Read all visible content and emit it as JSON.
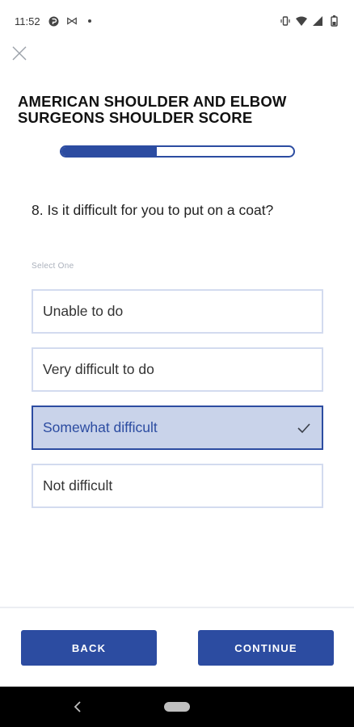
{
  "status_bar": {
    "time": "11:52",
    "left_icons": [
      "app-notification-icon",
      "media-icon",
      "dot-icon"
    ],
    "right_icons": [
      "vibrate-icon",
      "wifi-icon",
      "signal-icon",
      "battery-icon"
    ]
  },
  "header": {
    "close_icon": "close-icon",
    "title": "AMERICAN SHOULDER AND ELBOW SURGEONS SHOULDER SCORE"
  },
  "progress": {
    "fraction": 0.41
  },
  "question": {
    "text": "8. Is it difficult for you to put on a coat?",
    "hint": "Select One",
    "options": [
      {
        "label": "Unable to do",
        "selected": false
      },
      {
        "label": "Very difficult to do",
        "selected": false
      },
      {
        "label": "Somewhat difficult",
        "selected": true
      },
      {
        "label": "Not difficult",
        "selected": false
      }
    ]
  },
  "footer": {
    "back_label": "BACK",
    "continue_label": "CONTINUE"
  },
  "colors": {
    "primary": "#2c4ca1",
    "selected_bg": "#c9d3ea",
    "option_border": "#d3dbef"
  }
}
